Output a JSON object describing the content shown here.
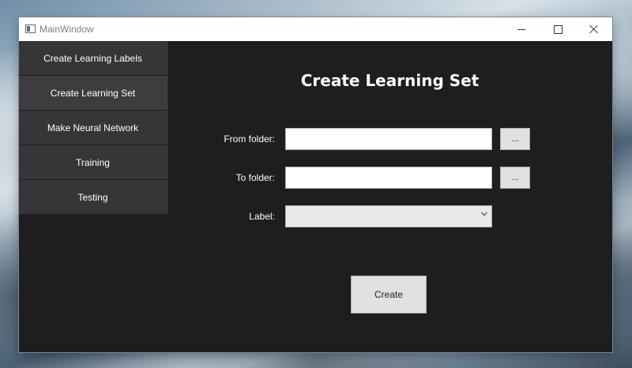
{
  "window": {
    "title": "MainWindow",
    "caption_buttons": [
      "minimize-icon",
      "maximize-icon",
      "close-icon"
    ]
  },
  "sidebar": {
    "items": [
      {
        "label": "Create Learning Labels",
        "active": false
      },
      {
        "label": "Create Learning Set",
        "active": true
      },
      {
        "label": "Make Neural Network",
        "active": false
      },
      {
        "label": "Training",
        "active": false
      },
      {
        "label": "Testing",
        "active": false
      }
    ]
  },
  "main": {
    "heading": "Create Learning Set",
    "from_folder": {
      "label": "From folder:",
      "value": "",
      "browse_label": "..."
    },
    "to_folder": {
      "label": "To folder:",
      "value": "",
      "browse_label": "..."
    },
    "label_select": {
      "label": "Label:",
      "selected": ""
    },
    "create_button": "Create"
  },
  "colors": {
    "window_background": "#1e1d20",
    "sidebar_button": "#363638",
    "button_face": "#e1e1e1",
    "text_light": "#ffffff"
  }
}
